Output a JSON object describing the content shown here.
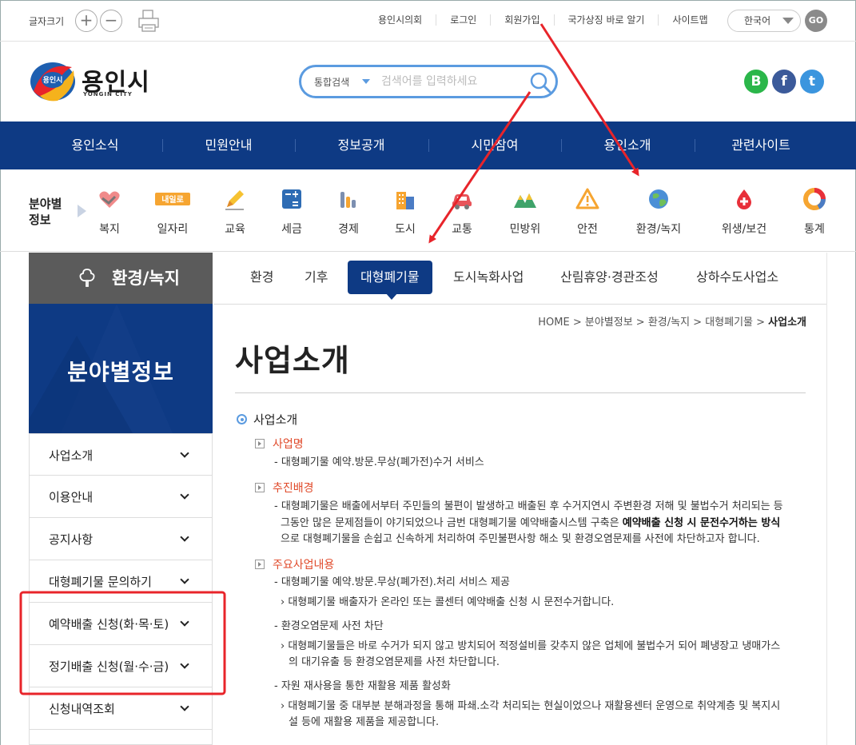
{
  "util": {
    "font_size_label": "글자크기",
    "font_plus": "+",
    "font_minus": "−",
    "links": [
      "용인시의회",
      "로그인",
      "회원가입",
      "국가상징 바로 알기",
      "사이트맵"
    ],
    "language": "한국어",
    "go": "GO"
  },
  "header": {
    "logo_text": "용인시",
    "logo_sub": "YONGIN CITY",
    "search_category": "통합검색",
    "search_placeholder": "검색어를 입력하세요",
    "social": [
      {
        "name": "blog",
        "glyph": "B",
        "color": "#2bb64a"
      },
      {
        "name": "facebook",
        "glyph": "f",
        "color": "#3b5a9a"
      },
      {
        "name": "twitter",
        "glyph": "t",
        "color": "#3b95de"
      }
    ]
  },
  "gnb": [
    "용인소식",
    "민원안내",
    "정보공개",
    "시민참여",
    "용인소개",
    "관련사이트"
  ],
  "categories": {
    "title_line1": "분야별",
    "title_line2": "정보",
    "items": [
      "복지",
      "일자리",
      "교육",
      "세금",
      "경제",
      "도시",
      "교통",
      "민방위",
      "안전",
      "환경/녹지",
      "위생/보건",
      "통계"
    ],
    "jobs_badge": "내일로"
  },
  "lnb": {
    "head": "환경/녹지",
    "banner": "분야별정보",
    "items": [
      "사업소개",
      "이용안내",
      "공지사항",
      "대형폐기물 문의하기",
      "예약배출 신청(화·목·토)",
      "정기배출 신청(월·수·금)",
      "신청내역조회"
    ]
  },
  "tabs": {
    "items": [
      "환경",
      "기후",
      "대형폐기물",
      "도시녹화사업",
      "산림휴양·경관조성",
      "상하수도사업소"
    ],
    "active": "대형폐기물"
  },
  "content": {
    "breadcrumb": "HOME > 분야별정보 > 환경/녹지 > 대형폐기물 > ",
    "breadcrumb_current": "사업소개",
    "page_title": "사업소개",
    "section_title": "사업소개",
    "s1_title": "사업명",
    "s1_line": "- 대형폐기물 예약.방문.무상(폐가전)수거 서비스",
    "s2_title": "추진배경",
    "s2_line1": "- 대형폐기물은 배출에서부터 주민들의 불편이 발생하고 배출된 후 수거지연시 주변환경 저해 및 불법수거 처리되는 등",
    "s2_line2a": "그동안 많은 문제점들이 야기되었으나 금번 대형폐기물 예약배출시스템 구축은 ",
    "s2_line2b": "예약배출 신청 시 문전수거하는 방식",
    "s2_line3": "으로 대형폐기물을 손쉽고 신속하게 처리하여 주민불편사항 해소 및 환경오염문제를 사전에 차단하고자 합니다.",
    "s3_title": "주요사업내용",
    "s3_a": "- 대형폐기물 예약.방문.무상(폐가전).처리 서비스 제공",
    "s3_a1": "› 대형폐기물 배출자가 온라인 또는 콜센터 예약배출 신청 시 문전수거합니다.",
    "s3_b": "- 환경오염문제 사전 차단",
    "s3_b1": "› 대형폐기물들은 바로 수거가 되지 않고 방치되어 적정설비를 갖추지 않은 업체에 불법수거 되어 폐냉장고 냉매가스",
    "s3_b2": "의 대기유출 등 환경오염문제를 사전 차단합니다.",
    "s3_c": "- 자원 재사용을 통한 재활용 제품 활성화",
    "s3_c1": "› 대형폐기물 중 대부분 분해과정을 통해 파쇄.소각 처리되는 현실이었으나 재활용센터 운영으로 취약계층 및 복지시",
    "s3_c2": "설 등에 재활용 제품을 제공합니다."
  },
  "colors": {
    "primary": "#0e3a84",
    "accent": "#e04a2a",
    "annotation": "#e8242a",
    "search_border": "#5b9be0"
  }
}
